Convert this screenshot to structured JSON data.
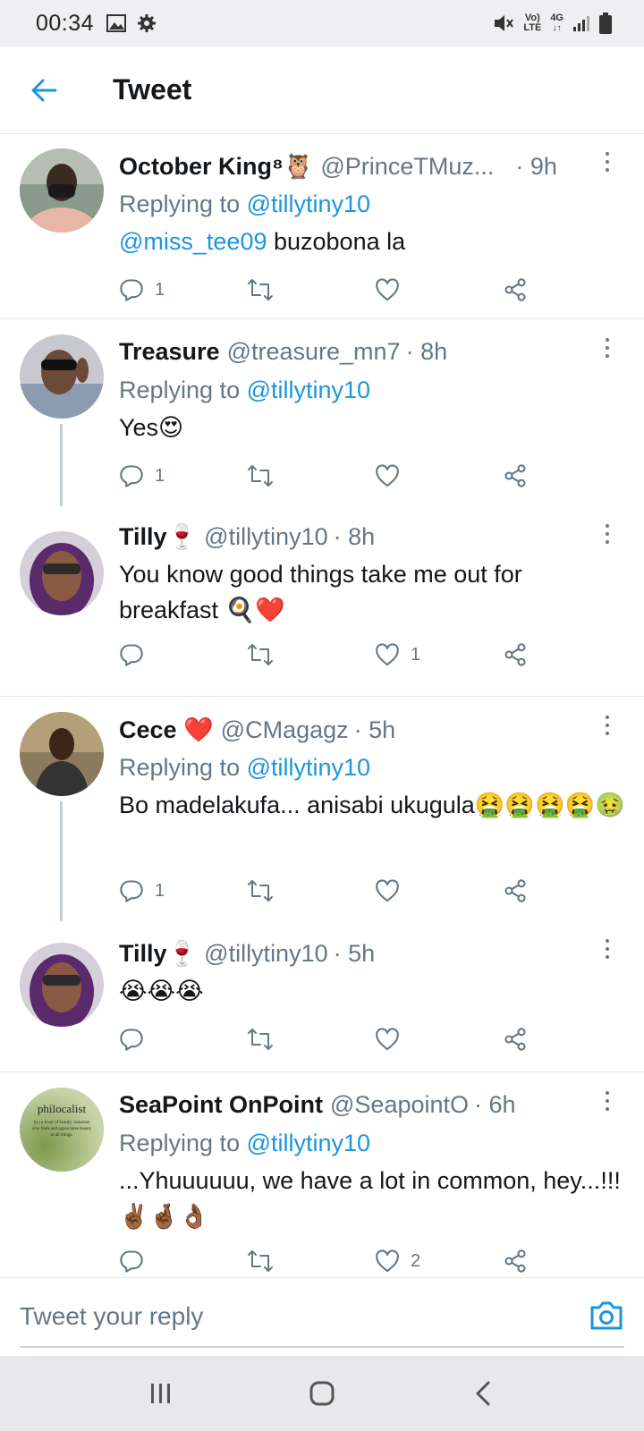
{
  "status_bar": {
    "time": "00:34",
    "volte_top": "Vo)",
    "volte_bottom": "LTE",
    "network": "4G"
  },
  "header": {
    "title": "Tweet"
  },
  "tweets": [
    {
      "name": "October King⁸🦉",
      "handle": "@PrinceTMuz...",
      "time": "· 9h",
      "replying_label": "Replying to",
      "replying_to": "@tillytiny10",
      "text_mention": "@miss_tee09",
      "text": " buzobona la",
      "replies": "1",
      "retweets": "",
      "likes": ""
    },
    {
      "name": "Treasure",
      "handle": "@treasure_mn7",
      "time": "· 8h",
      "replying_label": "Replying to",
      "replying_to": "@tillytiny10",
      "text": "Yes😍",
      "replies": "1",
      "retweets": "",
      "likes": ""
    },
    {
      "name": "Tilly🍷",
      "handle": "@tillytiny10",
      "time": "· 8h",
      "text": "You know good things take me out for breakfast 🍳❤️",
      "replies": "",
      "retweets": "",
      "likes": "1"
    },
    {
      "name": "Cece ❤️",
      "handle": "@CMagagz",
      "time": "· 5h",
      "replying_label": "Replying to",
      "replying_to": "@tillytiny10",
      "text": "Bo madelakufa... anisabi ukugula🤮🤮🤮🤮🤢",
      "replies": "1",
      "retweets": "",
      "likes": ""
    },
    {
      "name": "Tilly🍷",
      "handle": "@tillytiny10",
      "time": "· 5h",
      "text": "😭😭😭",
      "replies": "",
      "retweets": "",
      "likes": ""
    },
    {
      "name": "SeaPoint OnPoint",
      "handle": "@SeapointO",
      "time": "· 6h",
      "replying_label": "Replying to",
      "replying_to": "@tillytiny10",
      "text": "...Yhuuuuuu, we have a lot in common, hey...!!! ✌🏾🤞🏾👌🏾",
      "replies": "",
      "retweets": "",
      "likes": "2",
      "avatar_text": "philocalist",
      "avatar_subtext": "(n.) a lover of beauty; someone who finds and appreciates beauty in all things."
    }
  ],
  "compose": {
    "placeholder": "Tweet your reply"
  },
  "icons": {
    "back": "back-arrow-icon",
    "reply": "reply-icon",
    "retweet": "retweet-icon",
    "like": "heart-icon",
    "share": "share-icon",
    "camera": "camera-icon"
  },
  "colors": {
    "accent": "#1b95e0",
    "secondary_text": "#657786",
    "divider": "#e1e8ed"
  }
}
